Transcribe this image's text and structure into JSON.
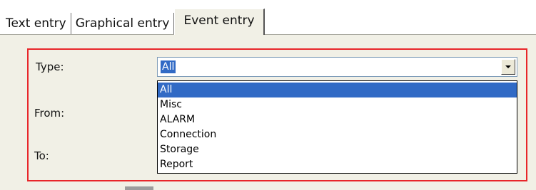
{
  "tabs": [
    {
      "label": "Text entry",
      "active": false
    },
    {
      "label": "Graphical entry",
      "active": false
    },
    {
      "label": "Event entry",
      "active": true
    }
  ],
  "form": {
    "type_label": "Type:",
    "from_label": "From:",
    "to_label": "To:",
    "type_value": "All"
  },
  "dropdown": {
    "options": [
      "All",
      "Misc",
      "ALARM",
      "Connection",
      "Storage",
      "Report"
    ],
    "selected_index": 0
  },
  "colors": {
    "highlight": "#316ac5",
    "outline": "#e8262a",
    "panel": "#f1f0e6"
  },
  "icons": {
    "combo_button": "chevron-down-icon"
  }
}
